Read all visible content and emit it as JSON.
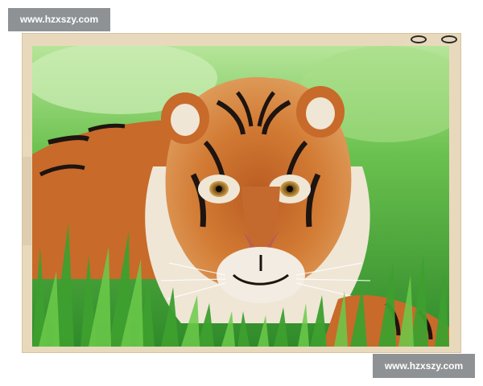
{
  "watermark": {
    "top_text": "www.hzxszy.com",
    "bottom_text": "www.hzxszy.com"
  },
  "photo": {
    "subject": "tiger-crouching-in-grass",
    "colors": {
      "grass_light": "#8fd46a",
      "grass_dark": "#2f8a2a",
      "fur_orange": "#c8682a",
      "fur_light": "#efe6d6",
      "stripe": "#1e1410"
    }
  },
  "frame": {
    "color": "#e8d9bd",
    "icons": [
      "frame-clip-icon",
      "frame-clip-icon"
    ]
  }
}
